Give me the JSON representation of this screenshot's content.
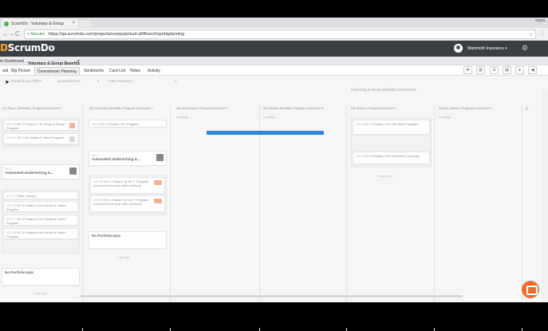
{
  "browser": {
    "tab_title": "ScrumDo : Voluntary & Group",
    "tab_close": "×",
    "user_chip": "kayla",
    "secure_label": "Secure",
    "url": "https://qa.scrumdo.com/projects/compute/sud-a5ff/sec#/sprintplanning",
    "nav_back": "←",
    "nav_forward": "→",
    "nav_reload": "C",
    "home": "⌂",
    "star": "☆",
    "menu": "⋮"
  },
  "app": {
    "logo_prefix": "D",
    "logo_text": "ScrumDo",
    "beta": "beta",
    "org_name": "Mammoth Insurance",
    "org_caret": "▾",
    "gear": "⚙"
  },
  "project_nav": {
    "back_label": "to Dashboard",
    "project_name": "Voluntary & Group Benefits",
    "caret": "▾"
  },
  "tabs": [
    {
      "label": "ard"
    },
    {
      "label": "Big Picture"
    },
    {
      "label": "Downstream Planning",
      "active": true
    },
    {
      "label": "Sentiments"
    },
    {
      "label": "Card List"
    },
    {
      "label": "Notes"
    },
    {
      "label": "Activity"
    }
  ],
  "toolbar_buttons": [
    "⇄",
    "▥",
    "☰",
    "▤",
    "●",
    "◀"
  ],
  "filters": {
    "f1": "Iteration",
    "f2": "Card Filters",
    "f3": "Dependencies",
    "f4": "Filter Iterations",
    "f5": "T"
  },
  "top_strip": {
    "label": "Preferring & Group Benefits | Innovations"
  },
  "columns": [
    {
      "title": "Q3 Plans | Release | Program Increment 7",
      "loading": ""
    },
    {
      "title": "Q3 Voluntary Benefits | Program Increment 7",
      "loading": ""
    },
    {
      "title": "Life Insurance | Product Increment 7",
      "loading": "Loading..."
    },
    {
      "title": "Q3 Worker Benefits | Program Increment 8",
      "loading": "Loading..."
    },
    {
      "title": "Life Rider | Product Increment 9",
      "loading": ""
    },
    {
      "title": "Dental | Vision | Program Increment 9",
      "loading": "Loading..."
    },
    {
      "title": "Q",
      "loading": ""
    }
  ],
  "cards": {
    "c1a": {
      "num": "VG-73",
      "title": "VG-7 Feature 1 To Setup & Group Program"
    },
    "c1b": {
      "num": "VG-74",
      "title": "VG-7 As Dental & Vision Program"
    },
    "c1c": {
      "num": "VG-1",
      "title": "VG-1"
    },
    "c1c_title": "Automated Underwriting &...",
    "c1d": {
      "num": "VG-71",
      "title": "Team Groups"
    },
    "c1e": {
      "num": "VG-75",
      "title": "VG-3 Feature 4 for Dental & Vision Program"
    },
    "c1f": {
      "num": "VG-77",
      "title": "VG-3 Feature 5 for Dental & Vision Program"
    },
    "c1g": {
      "num": "VG-75",
      "title": "VG-4 Feature 6 for Dental & Vision Program"
    },
    "c1h": {
      "title": "No Portfolio Epic"
    },
    "c2a": {
      "num": "VG-4",
      "title": "VG-7 Feature 3 In Program"
    },
    "c2b": {
      "num": "VG-7",
      "title": "VG-1"
    },
    "c2b_title": "Automated Underwriting &...",
    "c2c": {
      "num": "VG-31",
      "title": "VG-1 Feature 14 for IT Program (removed from epic after creation)"
    },
    "c2d": {
      "num": "VG-32",
      "title": "VG-1 Feature 14 for IT Program (removed from epic after creation)"
    },
    "c2e": {
      "title": "No Portfolio Epic"
    },
    "c5a": {
      "num": "VG-4",
      "title": "VG-7 Feature 2 for Life Rider Program"
    },
    "c5b": {
      "num": "VG-8",
      "title": "VG-2 Feature 2 for Extended Coverage"
    }
  },
  "add_links": {
    "col2": "+ Add Epic",
    "col5": "+ Add Card",
    "col1": "+ Add Epic"
  },
  "colors": {
    "header_bg": "#3b3f44",
    "accent_orange": "#f26d2b",
    "progress_blue": "#2f86d8"
  }
}
